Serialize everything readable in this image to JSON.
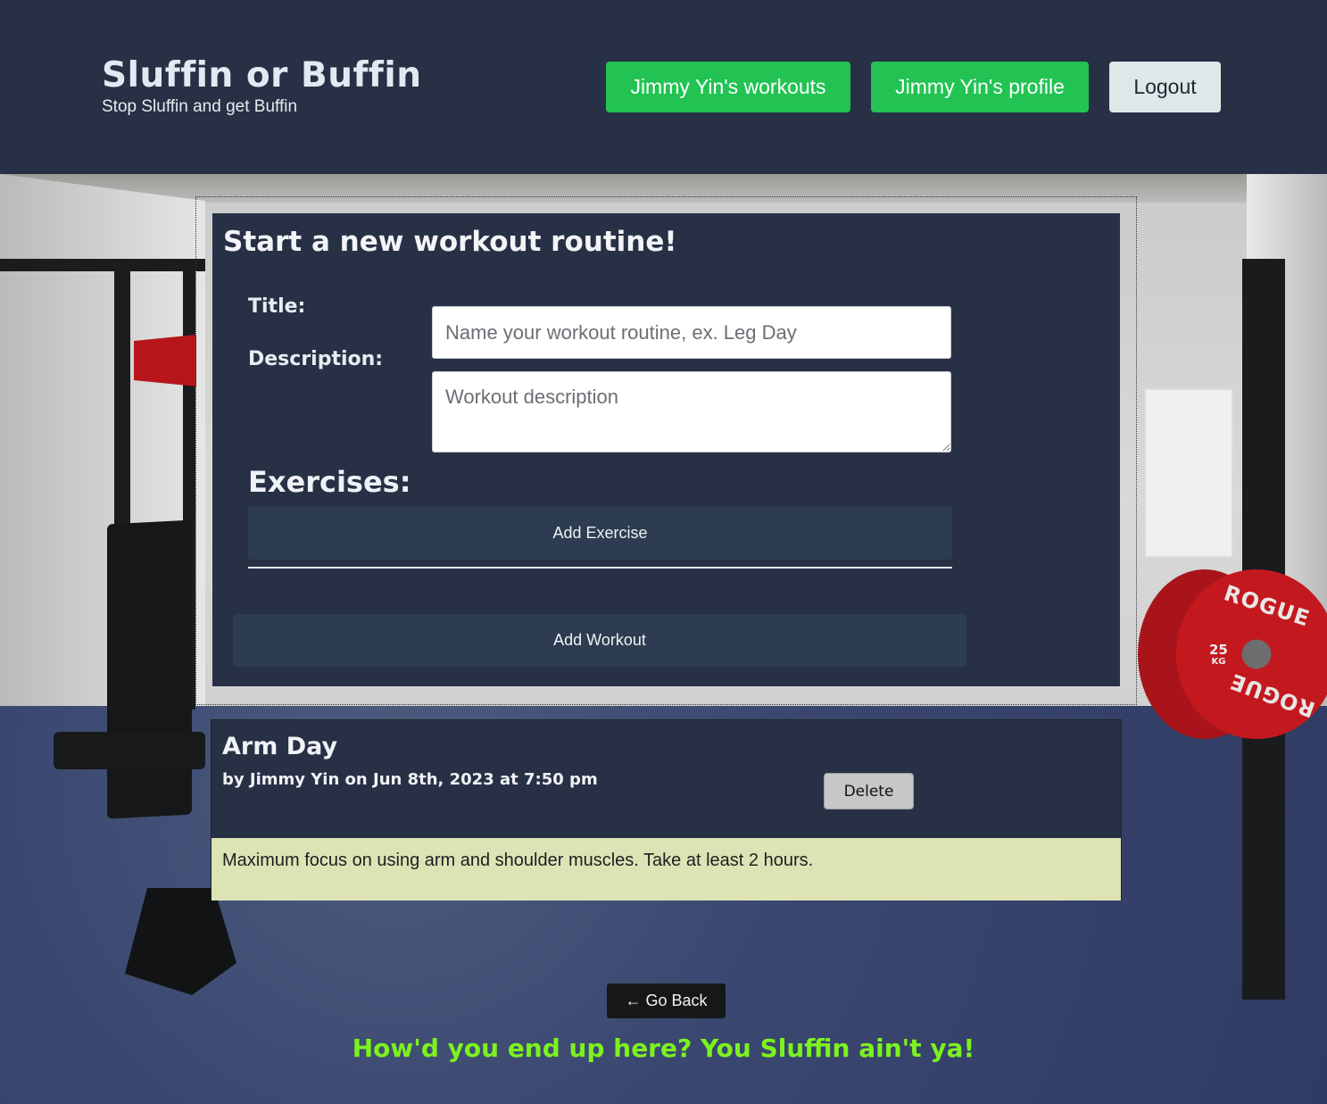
{
  "header": {
    "title": "Sluffin or Buffin",
    "subtitle": "Stop Sluffin and get Buffin",
    "nav": {
      "workouts_label": "Jimmy Yin's workouts",
      "profile_label": "Jimmy Yin's profile",
      "logout_label": "Logout"
    }
  },
  "new_workout_form": {
    "heading": "Start a new workout routine!",
    "title_label": "Title:",
    "title_placeholder": "Name your workout routine, ex. Leg Day",
    "title_value": "",
    "description_label": "Description:",
    "description_placeholder": "Workout description",
    "description_value": "",
    "exercises_label": "Exercises:",
    "add_exercise_label": "Add Exercise",
    "add_workout_label": "Add Workout"
  },
  "workouts": [
    {
      "title": "Arm Day",
      "meta": "by Jimmy Yin on Jun 8th, 2023 at 7:50 pm",
      "delete_label": "Delete",
      "description": "Maximum focus on using arm and shoulder muscles. Take at least 2 hours."
    }
  ],
  "footer": {
    "go_back_label": "← Go Back",
    "tagline": "How'd you end up here? You Sluffin ain't ya!"
  },
  "background": {
    "plate_brand": "ROGUE",
    "plate_weight": "25",
    "plate_unit": "KG"
  },
  "colors": {
    "header_bg": "#283045",
    "nav_green": "#22c353",
    "tagline_green": "#7cf21e",
    "workout_body_bg": "#dde3b4"
  }
}
